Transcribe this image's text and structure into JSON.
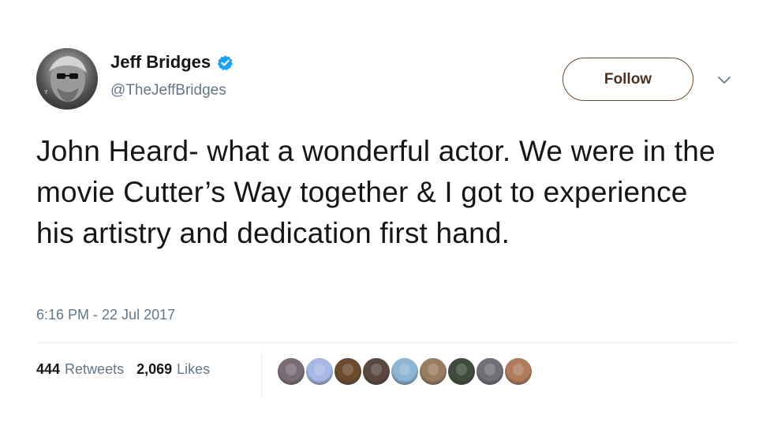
{
  "author": {
    "display_name": "Jeff Bridges",
    "handle": "@TheJeffBridges",
    "verified_color": "#1da1f2",
    "avatar": "profile-photo"
  },
  "actions": {
    "follow_label": "Follow",
    "more_icon": "chevron-down-icon"
  },
  "tweet": {
    "text": "John Heard- what a wonderful actor. We were in the movie Cutter’s Way together & I got to experience his artistry and dedication first hand.",
    "timestamp": "6:16 PM - 22 Jul 2017"
  },
  "stats": {
    "retweets_count": "444",
    "retweets_label": "Retweets",
    "likes_count": "2,069",
    "likes_label": "Likes"
  },
  "likers": [
    {
      "name": "liker-avatar",
      "color": "#7a6c74"
    },
    {
      "name": "liker-avatar",
      "color": "#a7b8e6"
    },
    {
      "name": "liker-avatar",
      "color": "#6b4a2e"
    },
    {
      "name": "liker-avatar",
      "color": "#5a4840"
    },
    {
      "name": "liker-avatar",
      "color": "#8fb5d4"
    },
    {
      "name": "liker-avatar",
      "color": "#9a7c62"
    },
    {
      "name": "liker-avatar",
      "color": "#3f4b3b"
    },
    {
      "name": "liker-avatar",
      "color": "#6f6f78"
    },
    {
      "name": "liker-avatar",
      "color": "#b07a5c"
    }
  ]
}
